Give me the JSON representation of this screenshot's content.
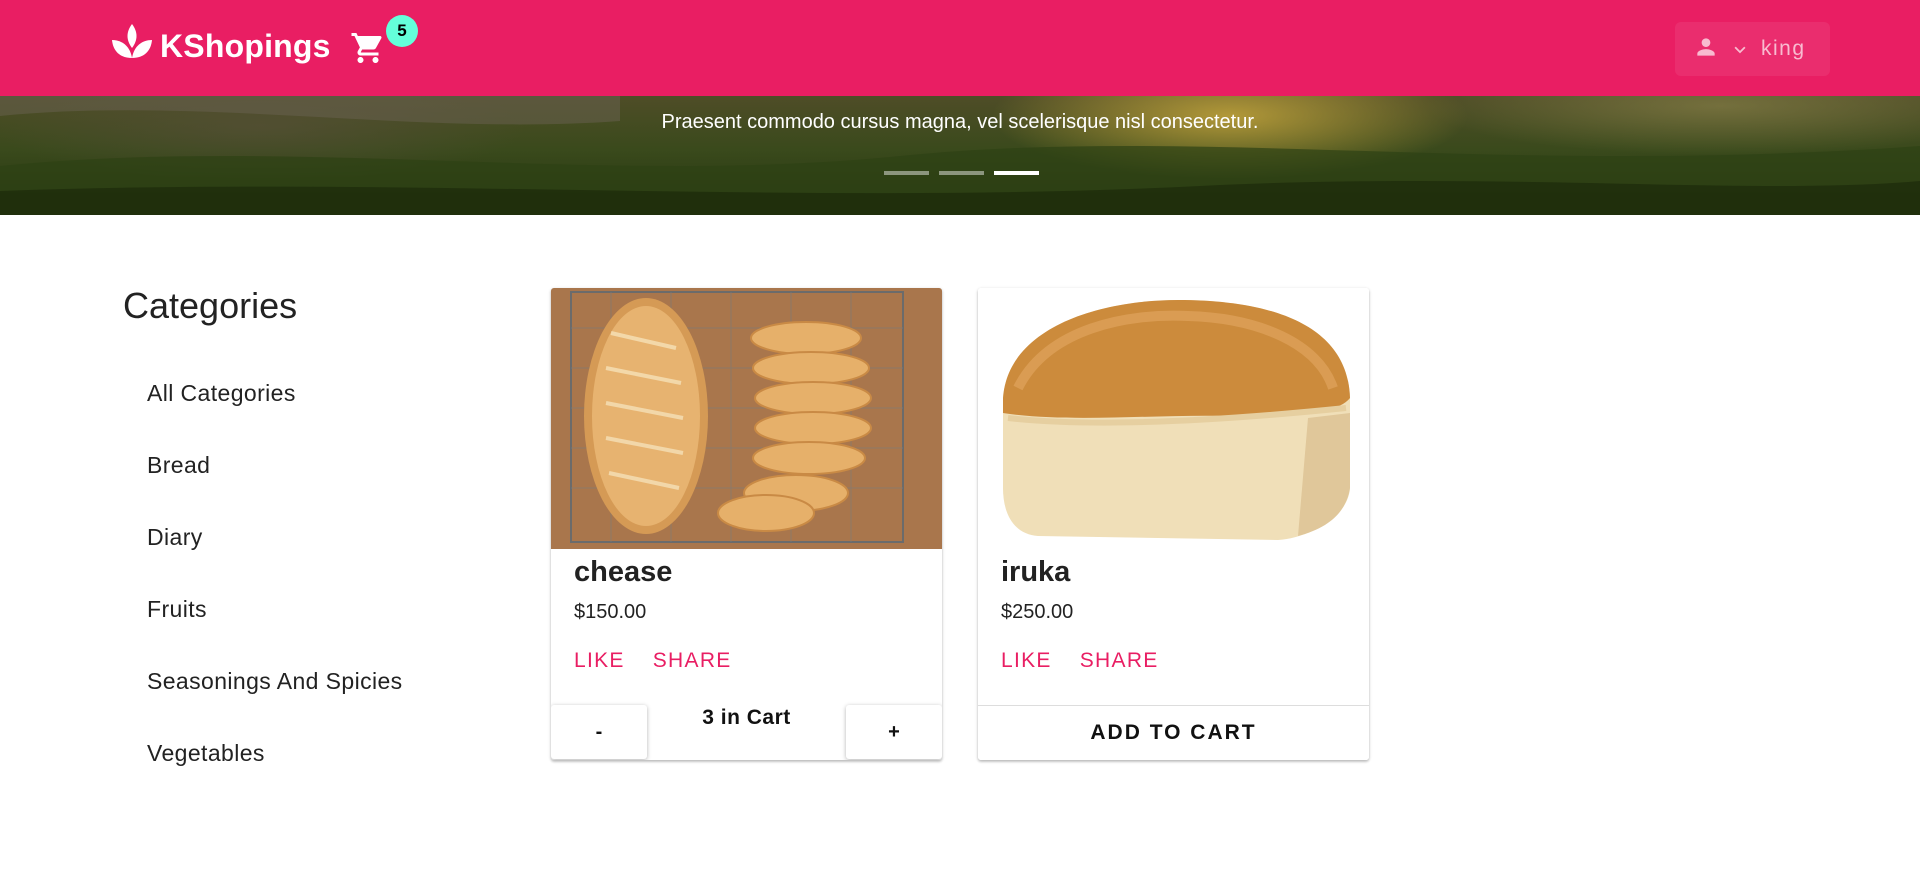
{
  "header": {
    "brand_name": "KShopings",
    "cart_count": "5",
    "user_name": "king",
    "colors": {
      "primary": "#e91e63",
      "badge": "#64ffda"
    }
  },
  "hero": {
    "caption": "Praesent commodo cursus magna, vel scelerisque nisl consectetur.",
    "slides_total": 3,
    "active_slide": 3
  },
  "sidebar": {
    "title": "Categories",
    "items": [
      {
        "label": "All Categories"
      },
      {
        "label": "Bread"
      },
      {
        "label": "Diary"
      },
      {
        "label": "Fruits"
      },
      {
        "label": "Seasonings And Spicies"
      },
      {
        "label": "Vegetables"
      }
    ]
  },
  "products": [
    {
      "name": "chease",
      "price": "$150.00",
      "like_label": "LIKE",
      "share_label": "SHARE",
      "minus_label": "-",
      "plus_label": "+",
      "cart_status": "3 in Cart"
    },
    {
      "name": "iruka",
      "price": "$250.00",
      "like_label": "LIKE",
      "share_label": "SHARE",
      "add_label": "ADD TO CART"
    }
  ]
}
